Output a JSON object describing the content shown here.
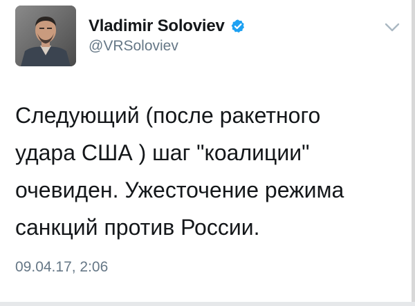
{
  "author": {
    "display_name": "Vladimir Soloviev",
    "handle": "@VRSoloviev",
    "verified": true,
    "avatar_icon": "user-avatar-photo"
  },
  "actions": {
    "menu_icon": "chevron-down-icon"
  },
  "tweet": {
    "lines": [
      "Следующий (после ракетного",
      "удара США ) шаг \"коалиции\"",
      "очевиден. Ужесточение режима",
      "санкций против России."
    ],
    "timestamp": "09.04.17, 2:06"
  },
  "colors": {
    "verified_badge": "#1da1f2",
    "secondary_text": "#657786",
    "primary_text": "#14171a",
    "chevron": "#aab8c2"
  }
}
